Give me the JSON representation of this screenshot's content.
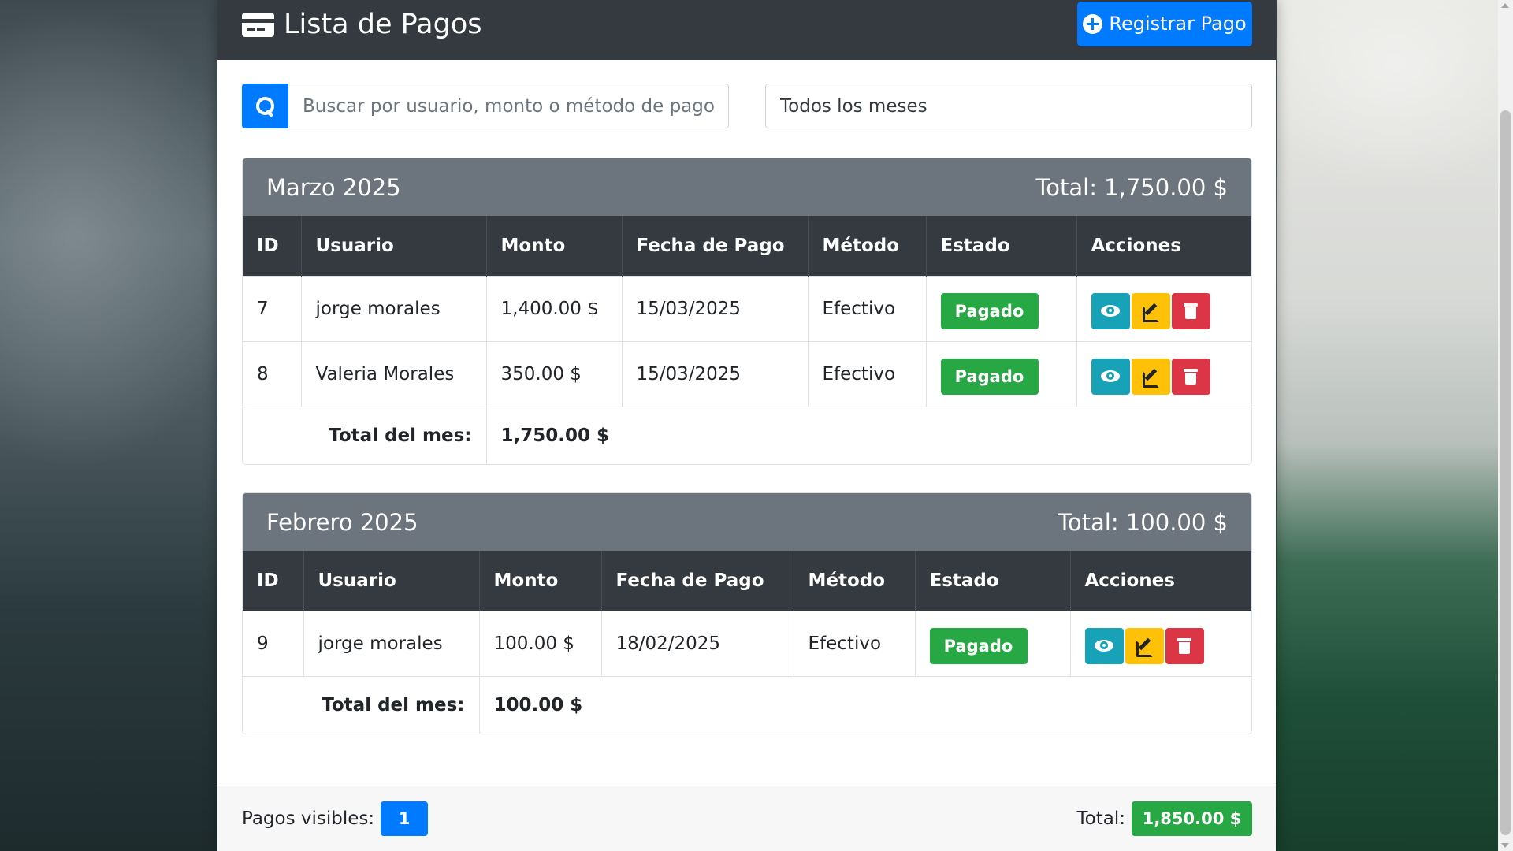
{
  "header": {
    "title": "Lista de Pagos",
    "register_button": "Registrar Pago"
  },
  "filters": {
    "search_placeholder": "Buscar por usuario, monto o método de pago...",
    "month_selected": "Todos los meses"
  },
  "columns": [
    "ID",
    "Usuario",
    "Monto",
    "Fecha de Pago",
    "Método",
    "Estado",
    "Acciones"
  ],
  "months": [
    {
      "name": "Marzo 2025",
      "total_label": "Total: 1,750.00 $",
      "rows": [
        {
          "id": "7",
          "usuario": "jorge morales",
          "monto": "1,400.00 $",
          "fecha": "15/03/2025",
          "metodo": "Efectivo",
          "estado": "Pagado"
        },
        {
          "id": "8",
          "usuario": "Valeria Morales",
          "monto": "350.00 $",
          "fecha": "15/03/2025",
          "metodo": "Efectivo",
          "estado": "Pagado"
        }
      ],
      "month_total_label": "Total del mes:",
      "month_total": "1,750.00 $"
    },
    {
      "name": "Febrero 2025",
      "total_label": "Total: 100.00 $",
      "rows": [
        {
          "id": "9",
          "usuario": "jorge morales",
          "monto": "100.00 $",
          "fecha": "18/02/2025",
          "metodo": "Efectivo",
          "estado": "Pagado"
        }
      ],
      "month_total_label": "Total del mes:",
      "month_total": "100.00 $"
    }
  ],
  "footer": {
    "visible_label": "Pagos visibles:",
    "visible_count": "1",
    "total_label": "Total:",
    "total_value": "1,850.00 $"
  },
  "colors": {
    "primary": "#007bff",
    "success": "#28a745",
    "info": "#17a2b8",
    "warning": "#ffc107",
    "danger": "#dc3545",
    "dark": "#343a40",
    "secondary": "#6c757d"
  },
  "icons": {
    "title": "credit-card-icon",
    "register": "plus-circle-icon",
    "search": "search-icon",
    "view": "eye-icon",
    "edit": "edit-icon",
    "delete": "trash-icon"
  }
}
